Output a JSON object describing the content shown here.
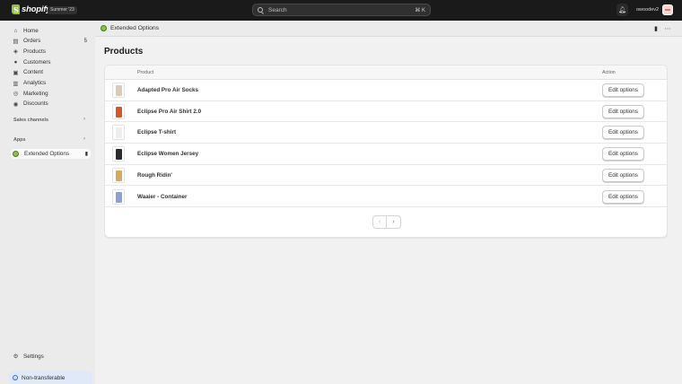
{
  "topbar": {
    "brand": "shopify",
    "edition": "Summer '23",
    "search_placeholder": "Search",
    "search_shortcut": "⌘ K",
    "store_name": "owoodev2"
  },
  "sidebar": {
    "items": [
      {
        "label": "Home",
        "icon": "home-icon",
        "glyph": "⌂"
      },
      {
        "label": "Orders",
        "icon": "orders-icon",
        "glyph": "▤",
        "badge": "5"
      },
      {
        "label": "Products",
        "icon": "products-icon",
        "glyph": "◈"
      },
      {
        "label": "Customers",
        "icon": "customers-icon",
        "glyph": "●"
      },
      {
        "label": "Content",
        "icon": "content-icon",
        "glyph": "▣"
      },
      {
        "label": "Analytics",
        "icon": "analytics-icon",
        "glyph": "▥"
      },
      {
        "label": "Marketing",
        "icon": "marketing-icon",
        "glyph": "◎"
      },
      {
        "label": "Discounts",
        "icon": "discounts-icon",
        "glyph": "◉"
      }
    ],
    "sales_channels_label": "Sales channels",
    "apps_label": "Apps",
    "app_item_label": "Extended Options",
    "settings_label": "Settings",
    "nontransferable_label": "Non-transferable"
  },
  "main": {
    "app_header_title": "Extended Options",
    "page_title": "Products",
    "table": {
      "col_product": "Product",
      "col_action": "Action",
      "rows": [
        {
          "name": "Adapted Pro Air Socks",
          "action": "Edit options",
          "thumb_color": "#d9cbb8"
        },
        {
          "name": "Eclipse Pro Air Shirt 2.0",
          "action": "Edit options",
          "thumb_color": "#d2582a"
        },
        {
          "name": "Eclipse T-shirt",
          "action": "Edit options",
          "thumb_color": "#eeeeee"
        },
        {
          "name": "Eclipse Women Jersey",
          "action": "Edit options",
          "thumb_color": "#2b2b2b"
        },
        {
          "name": "Rough Ridin'",
          "action": "Edit options",
          "thumb_color": "#d8a85f"
        },
        {
          "name": "Waaier - Container",
          "action": "Edit options",
          "thumb_color": "#8c9fd6"
        }
      ]
    }
  }
}
